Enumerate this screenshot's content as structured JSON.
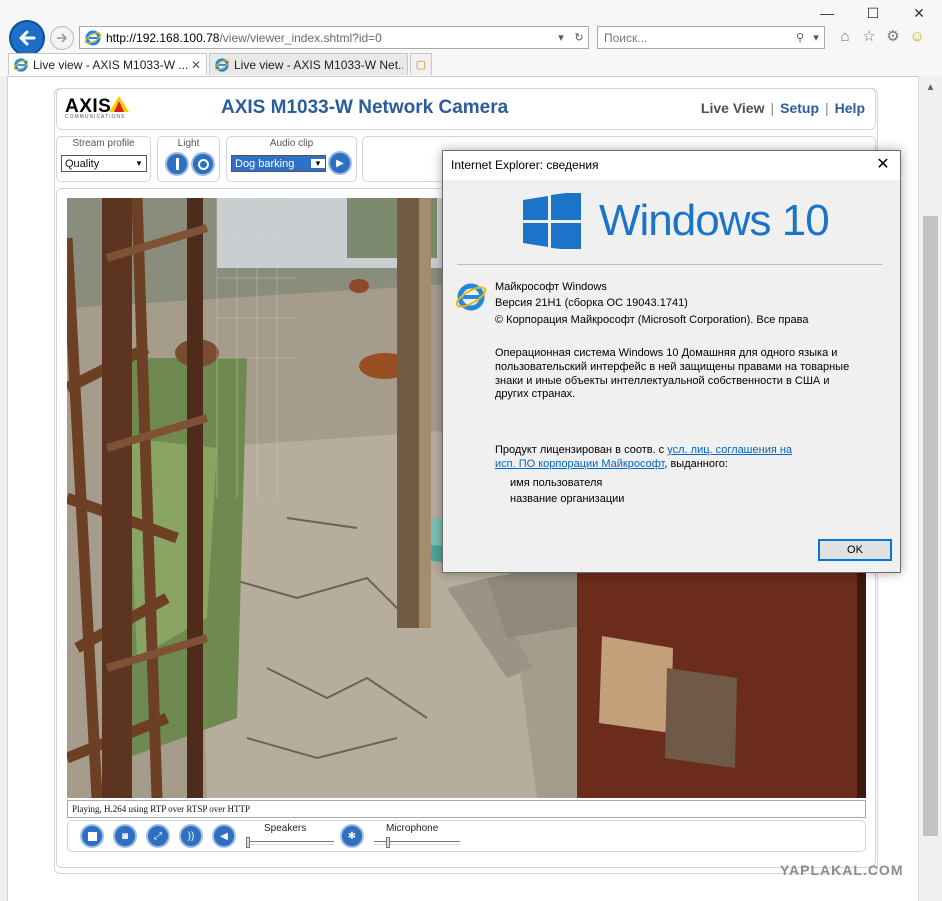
{
  "browser": {
    "url_host": "http://192.168.100.78",
    "url_path": "/view/viewer_index.shtml?id=0",
    "search_placeholder": "Поиск...",
    "tabs": [
      {
        "label": "Live view - AXIS M1033-W ..."
      },
      {
        "label": "Live view - AXIS M1033-W Net..."
      }
    ]
  },
  "camera_page": {
    "logo_text": "AXIS",
    "logo_sub": "COMMUNICATIONS",
    "title": "AXIS M1033-W Network Camera",
    "nav": {
      "live_view": "Live View",
      "setup": "Setup",
      "help": "Help"
    },
    "stream_profile": {
      "caption": "Stream profile",
      "value": "Quality"
    },
    "light": {
      "caption": "Light"
    },
    "audio_clip": {
      "caption": "Audio clip",
      "value": "Dog barking"
    },
    "status": "Playing, H.264 using RTP over RTSP over HTTP",
    "speakers_label": "Speakers",
    "microphone_label": "Microphone"
  },
  "dialog": {
    "title": "Internet Explorer: сведения",
    "brand": "Windows 10",
    "line1": "Майкрософт Windows",
    "line2": "Версия 21H1 (сборка ОС 19043.1741)",
    "line3": "© Корпорация Майкрософт (Microsoft Corporation). Все права",
    "para1": "Операционная система Windows 10 Домашняя для одного языка и",
    "para2": "пользовательский интерфейс в ней защищены правами на товарные",
    "para3": "знаки и иные объекты интеллектуальной собственности в США и",
    "para4": "других странах.",
    "license_pre": "Продукт лицензирован в соотв. с ",
    "license_link1": "усл. лиц. соглашения на",
    "license_link2": "исп. ПО корпорации Майкрософт",
    "license_post": ", выданного:",
    "user": "имя пользователя",
    "org": "название организации",
    "ok": "OK"
  },
  "watermark": "YAPLAKAL.COM",
  "colors": {
    "axis_blue": "#2a5d9a",
    "win_blue": "#1b74c8",
    "ie_blue": "#1b6fc8"
  }
}
